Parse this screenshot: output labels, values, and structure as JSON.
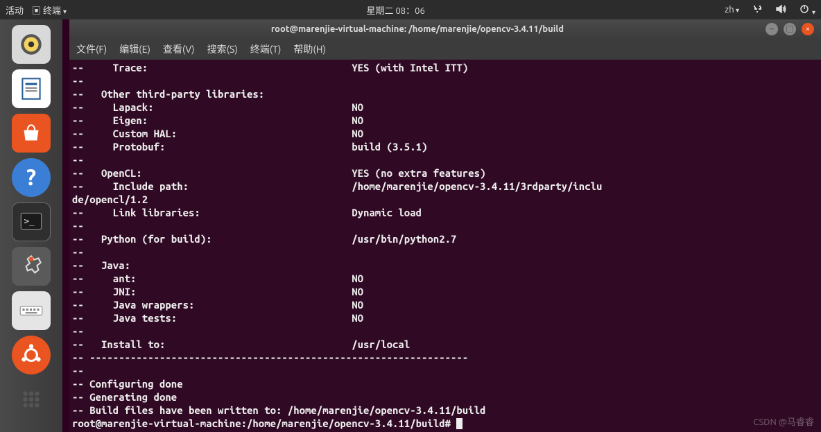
{
  "topbar": {
    "activities": "活动",
    "app_indicator": "终端",
    "clock": "星期二 08：06",
    "lang": "zh"
  },
  "launcher": {
    "items": [
      {
        "name": "rhythmbox",
        "bg": "#d9d9d9"
      },
      {
        "name": "libreoffice-writer",
        "bg": "#ffffff"
      },
      {
        "name": "ubuntu-software",
        "bg": "#e95420"
      },
      {
        "name": "help",
        "bg": "#3a7fd5"
      },
      {
        "name": "terminal",
        "bg": "#2f2f2f",
        "active": true
      },
      {
        "name": "settings",
        "bg": "#5a5a5a"
      },
      {
        "name": "keyboard",
        "bg": "#e5e5e5"
      },
      {
        "name": "ubuntu-logo",
        "bg": "#e95420"
      },
      {
        "name": "show-apps",
        "bg": "transparent"
      }
    ]
  },
  "window": {
    "title": "root@marenjie-virtual-machine: /home/marenjie/opencv-3.4.11/build",
    "menus": [
      "文件(F)",
      "编辑(E)",
      "查看(V)",
      "搜索(S)",
      "终端(T)",
      "帮助(H)"
    ]
  },
  "terminal": {
    "lines": [
      "--     Trace:                                   YES (with Intel ITT)",
      "--",
      "--   Other third-party libraries:",
      "--     Lapack:                                  NO",
      "--     Eigen:                                   NO",
      "--     Custom HAL:                              NO",
      "--     Protobuf:                                build (3.5.1)",
      "--",
      "--   OpenCL:                                    YES (no extra features)",
      "--     Include path:                            /home/marenjie/opencv-3.4.11/3rdparty/inclu",
      "de/opencl/1.2",
      "--     Link libraries:                          Dynamic load",
      "--",
      "--   Python (for build):                        /usr/bin/python2.7",
      "--",
      "--   Java:",
      "--     ant:                                     NO",
      "--     JNI:                                     NO",
      "--     Java wrappers:                           NO",
      "--     Java tests:                              NO",
      "--",
      "--   Install to:                                /usr/local",
      "-- -----------------------------------------------------------------",
      "--",
      "-- Configuring done",
      "-- Generating done",
      "-- Build files have been written to: /home/marenjie/opencv-3.4.11/build"
    ],
    "prompt": "root@marenjie-virtual-machine:/home/marenjie/opencv-3.4.11/build# "
  },
  "watermark": "CSDN @马睿睿"
}
